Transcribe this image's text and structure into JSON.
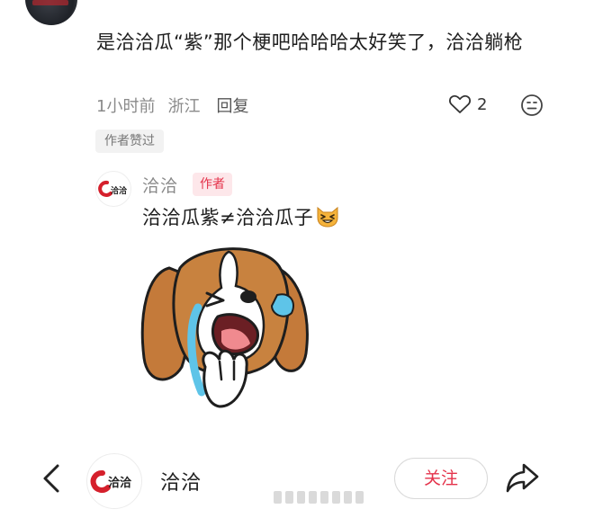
{
  "comment": {
    "username": "",
    "text": "是洽洽瓜“紫”那个梗吧哈哈哈太好笑了，洽洽躺枪",
    "time": "1小时前",
    "location": "浙江",
    "reply_label": "回复",
    "like_count": "2",
    "author_liked_badge": "作者赞过"
  },
  "reply": {
    "username": "洽洽",
    "author_tag": "作者",
    "text": "洽洽瓜紫≠洽洽瓜子",
    "logo_text": "洽洽",
    "icons": {
      "emoji": "grinning-squint-cat-emoji",
      "sticker": "crying-beagle-sticker"
    }
  },
  "bottom_bar": {
    "account_name": "洽洽",
    "logo_text": "洽洽",
    "follow_label": "关注"
  },
  "colors": {
    "brand_red": "#d5202c",
    "author_tag_bg": "#fde7ea",
    "author_tag_text": "#e4324a",
    "meta_gray": "#8a8a8a"
  }
}
